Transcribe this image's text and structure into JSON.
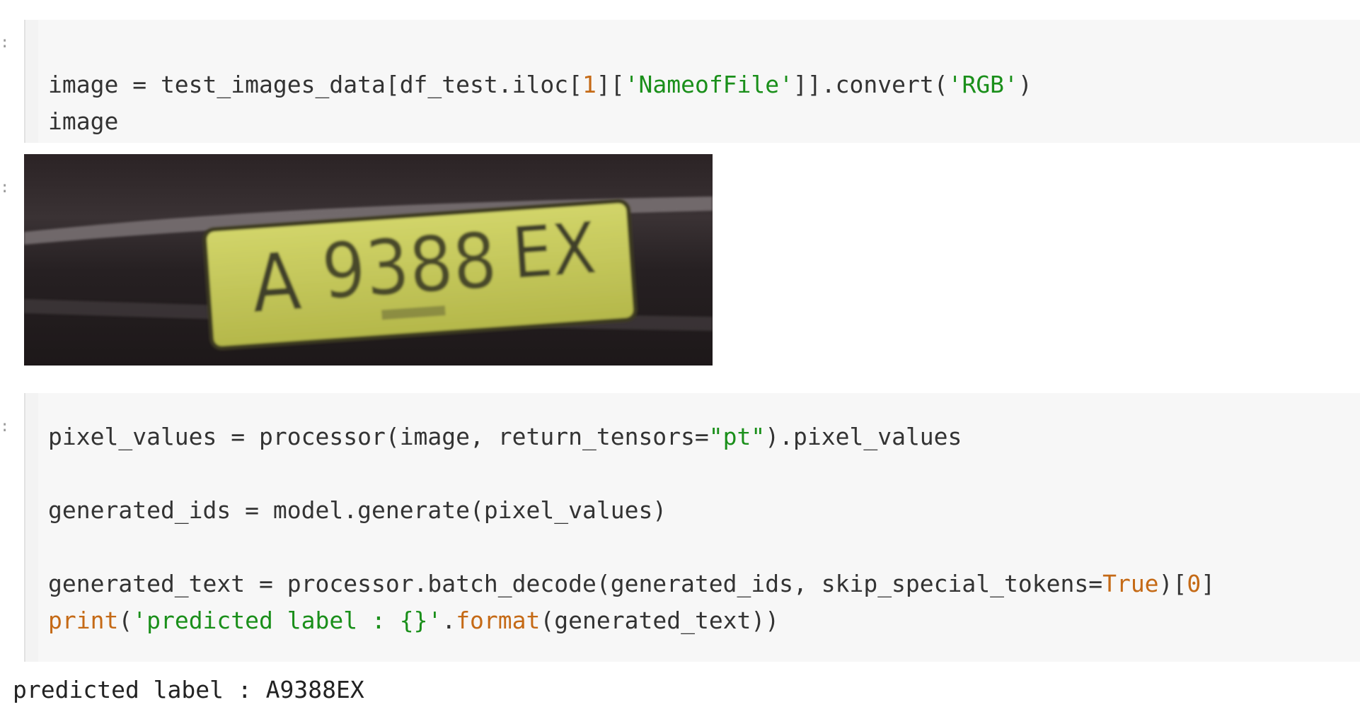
{
  "cells": {
    "cell1": {
      "line1": {
        "a": "image = test_images_data[df_test.iloc[",
        "num": "1",
        "b": "][",
        "str1": "'NameofFile'",
        "c": "]].convert(",
        "str2": "'RGB'",
        "d": ")"
      },
      "line2": "image"
    },
    "cell2": {
      "line1": {
        "a": "pixel_values = processor(image, return_tensors=",
        "str": "\"pt\"",
        "b": ").pixel_values"
      },
      "line2": "generated_ids = model.generate(pixel_values)",
      "line3": {
        "a": "generated_text = processor.batch_decode(generated_ids, skip_special_tokens=",
        "kw": "True",
        "b": ")[",
        "num": "0",
        "c": "]"
      },
      "line4": {
        "fn": "print",
        "a": "(",
        "str": "'predicted label : {}'",
        "b": ".",
        "fn2": "format",
        "c": "(generated_text))"
      }
    }
  },
  "image_output": {
    "plate_text_left": "A",
    "plate_number": "9388",
    "plate_text_right": "EX",
    "plate_color": "#c7c95a",
    "background_color": "#2a2224"
  },
  "result": {
    "text": "predicted label : A9388EX"
  }
}
